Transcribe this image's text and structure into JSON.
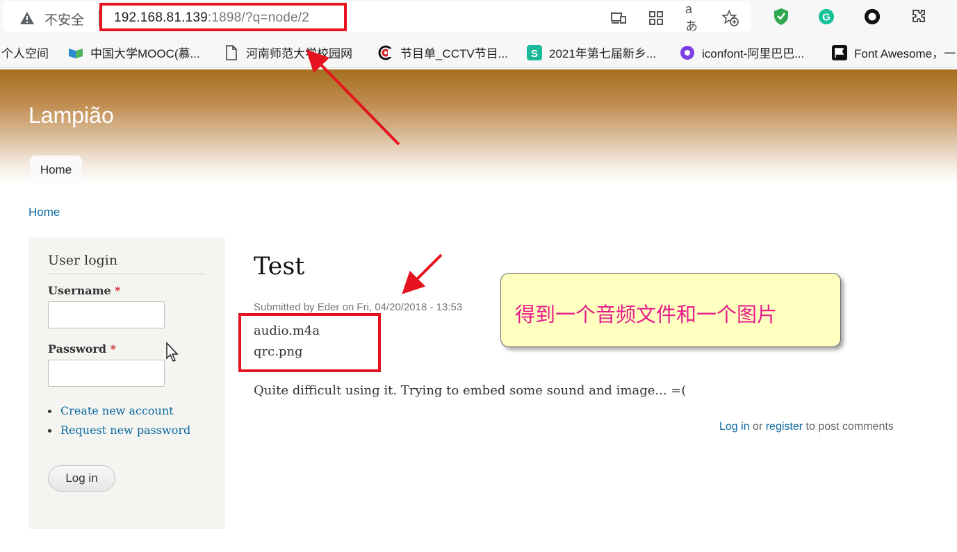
{
  "browser": {
    "security_label": "不安全",
    "url_host": "192.168.81.139",
    "url_rest": ":1898/?q=node/2",
    "bookmarks": [
      {
        "label": "个人空间",
        "icon": "none"
      },
      {
        "label": "中国大学MOOC(慕...",
        "icon": "mooc-icon"
      },
      {
        "label": "河南师范大学校园网",
        "icon": "page-icon"
      },
      {
        "label": "节目单_CCTV节目...",
        "icon": "cctv-icon"
      },
      {
        "label": "2021年第七届新乡...",
        "icon": "s-icon"
      },
      {
        "label": "iconfont-阿里巴巴...",
        "icon": "iconfont-icon"
      },
      {
        "label": "Font Awesome，一",
        "icon": "flag-icon"
      }
    ],
    "toolbar_icons": [
      "device-icon",
      "apps-icon",
      "translate-icon",
      "favorite-icon",
      "shield-extension-icon",
      "grammarly-icon",
      "circle-extension-icon",
      "extensions-icon"
    ]
  },
  "site": {
    "name": "Lampião",
    "tab_home": "Home",
    "breadcrumb": "Home"
  },
  "login": {
    "title": "User login",
    "username_label": "Username",
    "password_label": "Password",
    "required_mark": "*",
    "create_account": "Create new account",
    "request_password": "Request new password",
    "button": "Log in"
  },
  "node": {
    "title": "Test",
    "submitted": "Submitted by Eder on Fri, 04/20/2018 - 13:53",
    "attachments": [
      "audio.m4a",
      "qrc.png"
    ],
    "body": "Quite difficult using it. Trying to embed some sound and image... =(",
    "comments_login": "Log in",
    "comments_or": " or ",
    "comments_register": "register",
    "comments_suffix": " to post comments"
  },
  "annotation": {
    "note": "得到一个音频文件和一个图片",
    "color": "#e5121f",
    "note_color": "#e51e8c"
  }
}
